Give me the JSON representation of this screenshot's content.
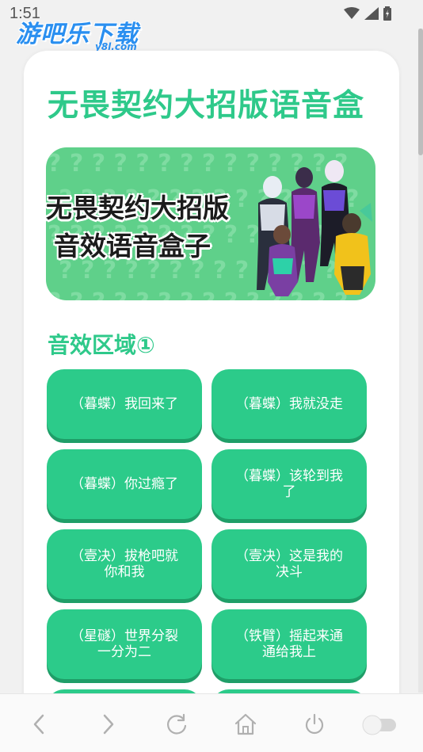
{
  "status_bar": {
    "time": "1:51"
  },
  "watermark": {
    "main": "游吧乐下载",
    "sub": "y8l.com"
  },
  "page": {
    "title": "无畏契约大招版语音盒"
  },
  "banner": {
    "line1": "无畏契约大招版",
    "line2": "音效语音盒子"
  },
  "section": {
    "title": "音效区域①"
  },
  "buttons": [
    {
      "label": "（暮蝶）我回来了"
    },
    {
      "label": "（暮蝶）我就没走"
    },
    {
      "label": "（暮蝶）你过瘾了"
    },
    {
      "label": "（暮蝶）该轮到我了"
    },
    {
      "label": "（壹决）拔枪吧就你和我"
    },
    {
      "label": "（壹决）这是我的决斗"
    },
    {
      "label": "（星礈）世界分裂一分为二"
    },
    {
      "label": "（铁臂）摇起来通通给我上"
    },
    {
      "label": ""
    },
    {
      "label": ""
    }
  ],
  "colors": {
    "accent": "#2ccb8a",
    "button_shadow": "#1f9e68",
    "banner_bg": "#5fd08a"
  },
  "nav": {
    "icons": [
      "back-icon",
      "forward-icon",
      "refresh-icon",
      "home-icon",
      "power-icon",
      "toggle-switch"
    ]
  }
}
